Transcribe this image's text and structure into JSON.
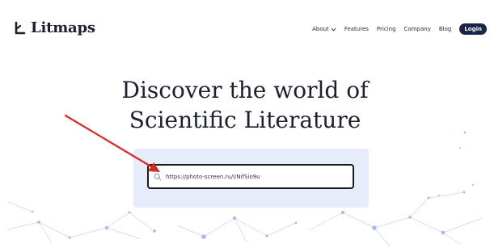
{
  "brand": {
    "name": "Litmaps"
  },
  "nav": {
    "items": [
      "About",
      "Features",
      "Pricing",
      "Company",
      "Blog"
    ],
    "login_label": "Login"
  },
  "hero": {
    "line1": "Discover the world of",
    "line2": "Scientific Literature"
  },
  "search": {
    "value": "https://photo-screen.ru/i/NifSio9u",
    "placeholder": ""
  },
  "colors": {
    "primary_dark": "#1b2447",
    "panel_bg": "#e7ecfb",
    "annotation_arrow": "#d42a2a"
  },
  "icons": {
    "logo": "litmaps-logo-icon",
    "about_dropdown": "chevron-down-icon",
    "search": "search-icon"
  }
}
